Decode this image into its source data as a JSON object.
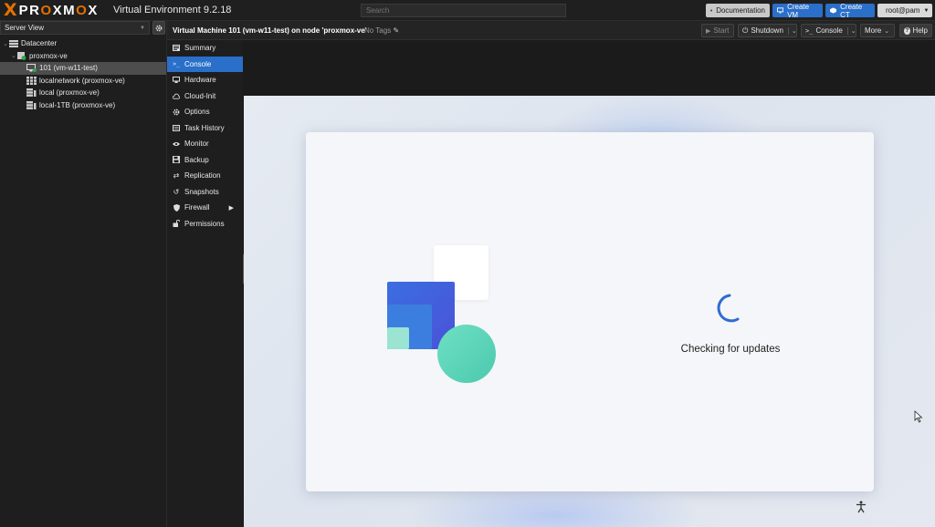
{
  "topbar": {
    "logo_x": "X",
    "logo_word_pre": "PR",
    "logo_word_o1": "O",
    "logo_word_mid": "XM",
    "logo_word_o2": "O",
    "logo_word_post": "X",
    "version": "Virtual Environment 9.2.18",
    "search_placeholder": "Search",
    "documentation": "Documentation",
    "create_vm": "Create VM",
    "create_ct": "Create CT",
    "user": "root@pam"
  },
  "left": {
    "view_select": "Server View",
    "tree": [
      {
        "label": "Datacenter",
        "icon": "datacenter-icon"
      },
      {
        "label": "proxmox-ve",
        "icon": "node-icon"
      },
      {
        "label": "101 (vm-w11-test)",
        "icon": "vm-icon"
      },
      {
        "label": "localnetwork (proxmox-ve)",
        "icon": "network-icon"
      },
      {
        "label": "local (proxmox-ve)",
        "icon": "storage-icon"
      },
      {
        "label": "local-1TB (proxmox-ve)",
        "icon": "storage-icon"
      }
    ]
  },
  "vm_header": {
    "title": "Virtual Machine 101 (vm-w11-test) on node 'proxmox-ve'",
    "tags": "No Tags",
    "start": "Start",
    "shutdown": "Shutdown",
    "console": "Console",
    "more": "More",
    "help": "Help"
  },
  "nav": [
    {
      "label": "Summary",
      "icon": "summary-icon"
    },
    {
      "label": "Console",
      "icon": "console-icon",
      "selected": true
    },
    {
      "label": "Hardware",
      "icon": "monitor-icon"
    },
    {
      "label": "Cloud-Init",
      "icon": "cloud-icon"
    },
    {
      "label": "Options",
      "icon": "gear-icon"
    },
    {
      "label": "Task History",
      "icon": "list-icon"
    },
    {
      "label": "Monitor",
      "icon": "eye-icon"
    },
    {
      "label": "Backup",
      "icon": "floppy-icon"
    },
    {
      "label": "Replication",
      "icon": "retweet-icon"
    },
    {
      "label": "Snapshots",
      "icon": "history-icon"
    },
    {
      "label": "Firewall",
      "icon": "shield-icon"
    },
    {
      "label": "Permissions",
      "icon": "unlock-icon"
    }
  ],
  "console_screen": {
    "status_text": "Checking for updates"
  },
  "colors": {
    "accent": "#2a6fc9",
    "brand_orange": "#e57000"
  }
}
